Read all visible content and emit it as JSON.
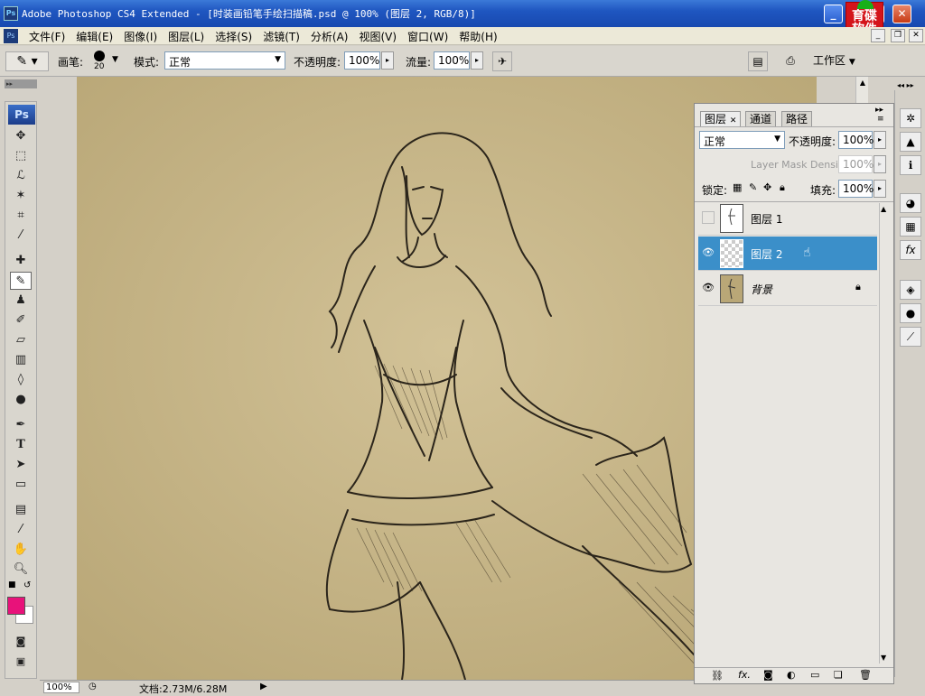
{
  "window": {
    "title": "Adobe Photoshop CS4 Extended - [时装画铅笔手绘扫描稿.psd @ 100% (图层 2, RGB/8)]",
    "app_icon": "Ps",
    "minimize": "_",
    "restore": "❐",
    "close": "✕"
  },
  "logo": {
    "line1": "育碟",
    "line2": "软件"
  },
  "menu": {
    "items": [
      "文件(F)",
      "编辑(E)",
      "图像(I)",
      "图层(L)",
      "选择(S)",
      "滤镜(T)",
      "分析(A)",
      "视图(V)",
      "窗口(W)",
      "帮助(H)"
    ]
  },
  "options": {
    "brush_label": "画笔:",
    "brush_size": "20",
    "mode_label": "模式:",
    "mode_value": "正常",
    "opacity_label": "不透明度:",
    "opacity_value": "100%",
    "flow_label": "流量:",
    "flow_value": "100%",
    "workspace_label": "工作区"
  },
  "toolbox": {
    "logo": "Ps",
    "tools": [
      "move-tool",
      "marquee-tool",
      "lasso-tool",
      "magic-wand-tool",
      "crop-tool",
      "eyedropper-tool",
      "healing-tool",
      "brush-tool",
      "clone-stamp-tool",
      "history-brush-tool",
      "eraser-tool",
      "gradient-tool",
      "blur-tool",
      "dodge-tool",
      "pen-tool",
      "type-tool",
      "path-selection-tool",
      "shape-tool",
      "notes-tool",
      "eyedropper2-tool",
      "hand-tool",
      "zoom-tool"
    ],
    "foreground_color": "#e8127a",
    "background_color": "#ffffff"
  },
  "status": {
    "zoom": "100%",
    "doc_info": "文档:2.73M/6.28M"
  },
  "layers_panel": {
    "tabs": [
      "图层",
      "通道",
      "路径"
    ],
    "blend_mode": "正常",
    "opacity_label": "不透明度:",
    "opacity_value": "100%",
    "mask_density_label": "Layer Mask Density",
    "mask_density_value": "100%",
    "lock_label": "锁定:",
    "fill_label": "填充:",
    "fill_value": "100%",
    "layers": [
      {
        "name": "图层 1",
        "visible": false,
        "selected": false,
        "locked": false
      },
      {
        "name": "图层 2",
        "visible": true,
        "selected": true,
        "locked": false
      },
      {
        "name": "背景",
        "visible": true,
        "selected": false,
        "locked": true
      }
    ]
  },
  "colors": {
    "title_bar": "#1f56c0",
    "selected_layer": "#3b8fc9",
    "canvas_paper": "#c6b485"
  }
}
